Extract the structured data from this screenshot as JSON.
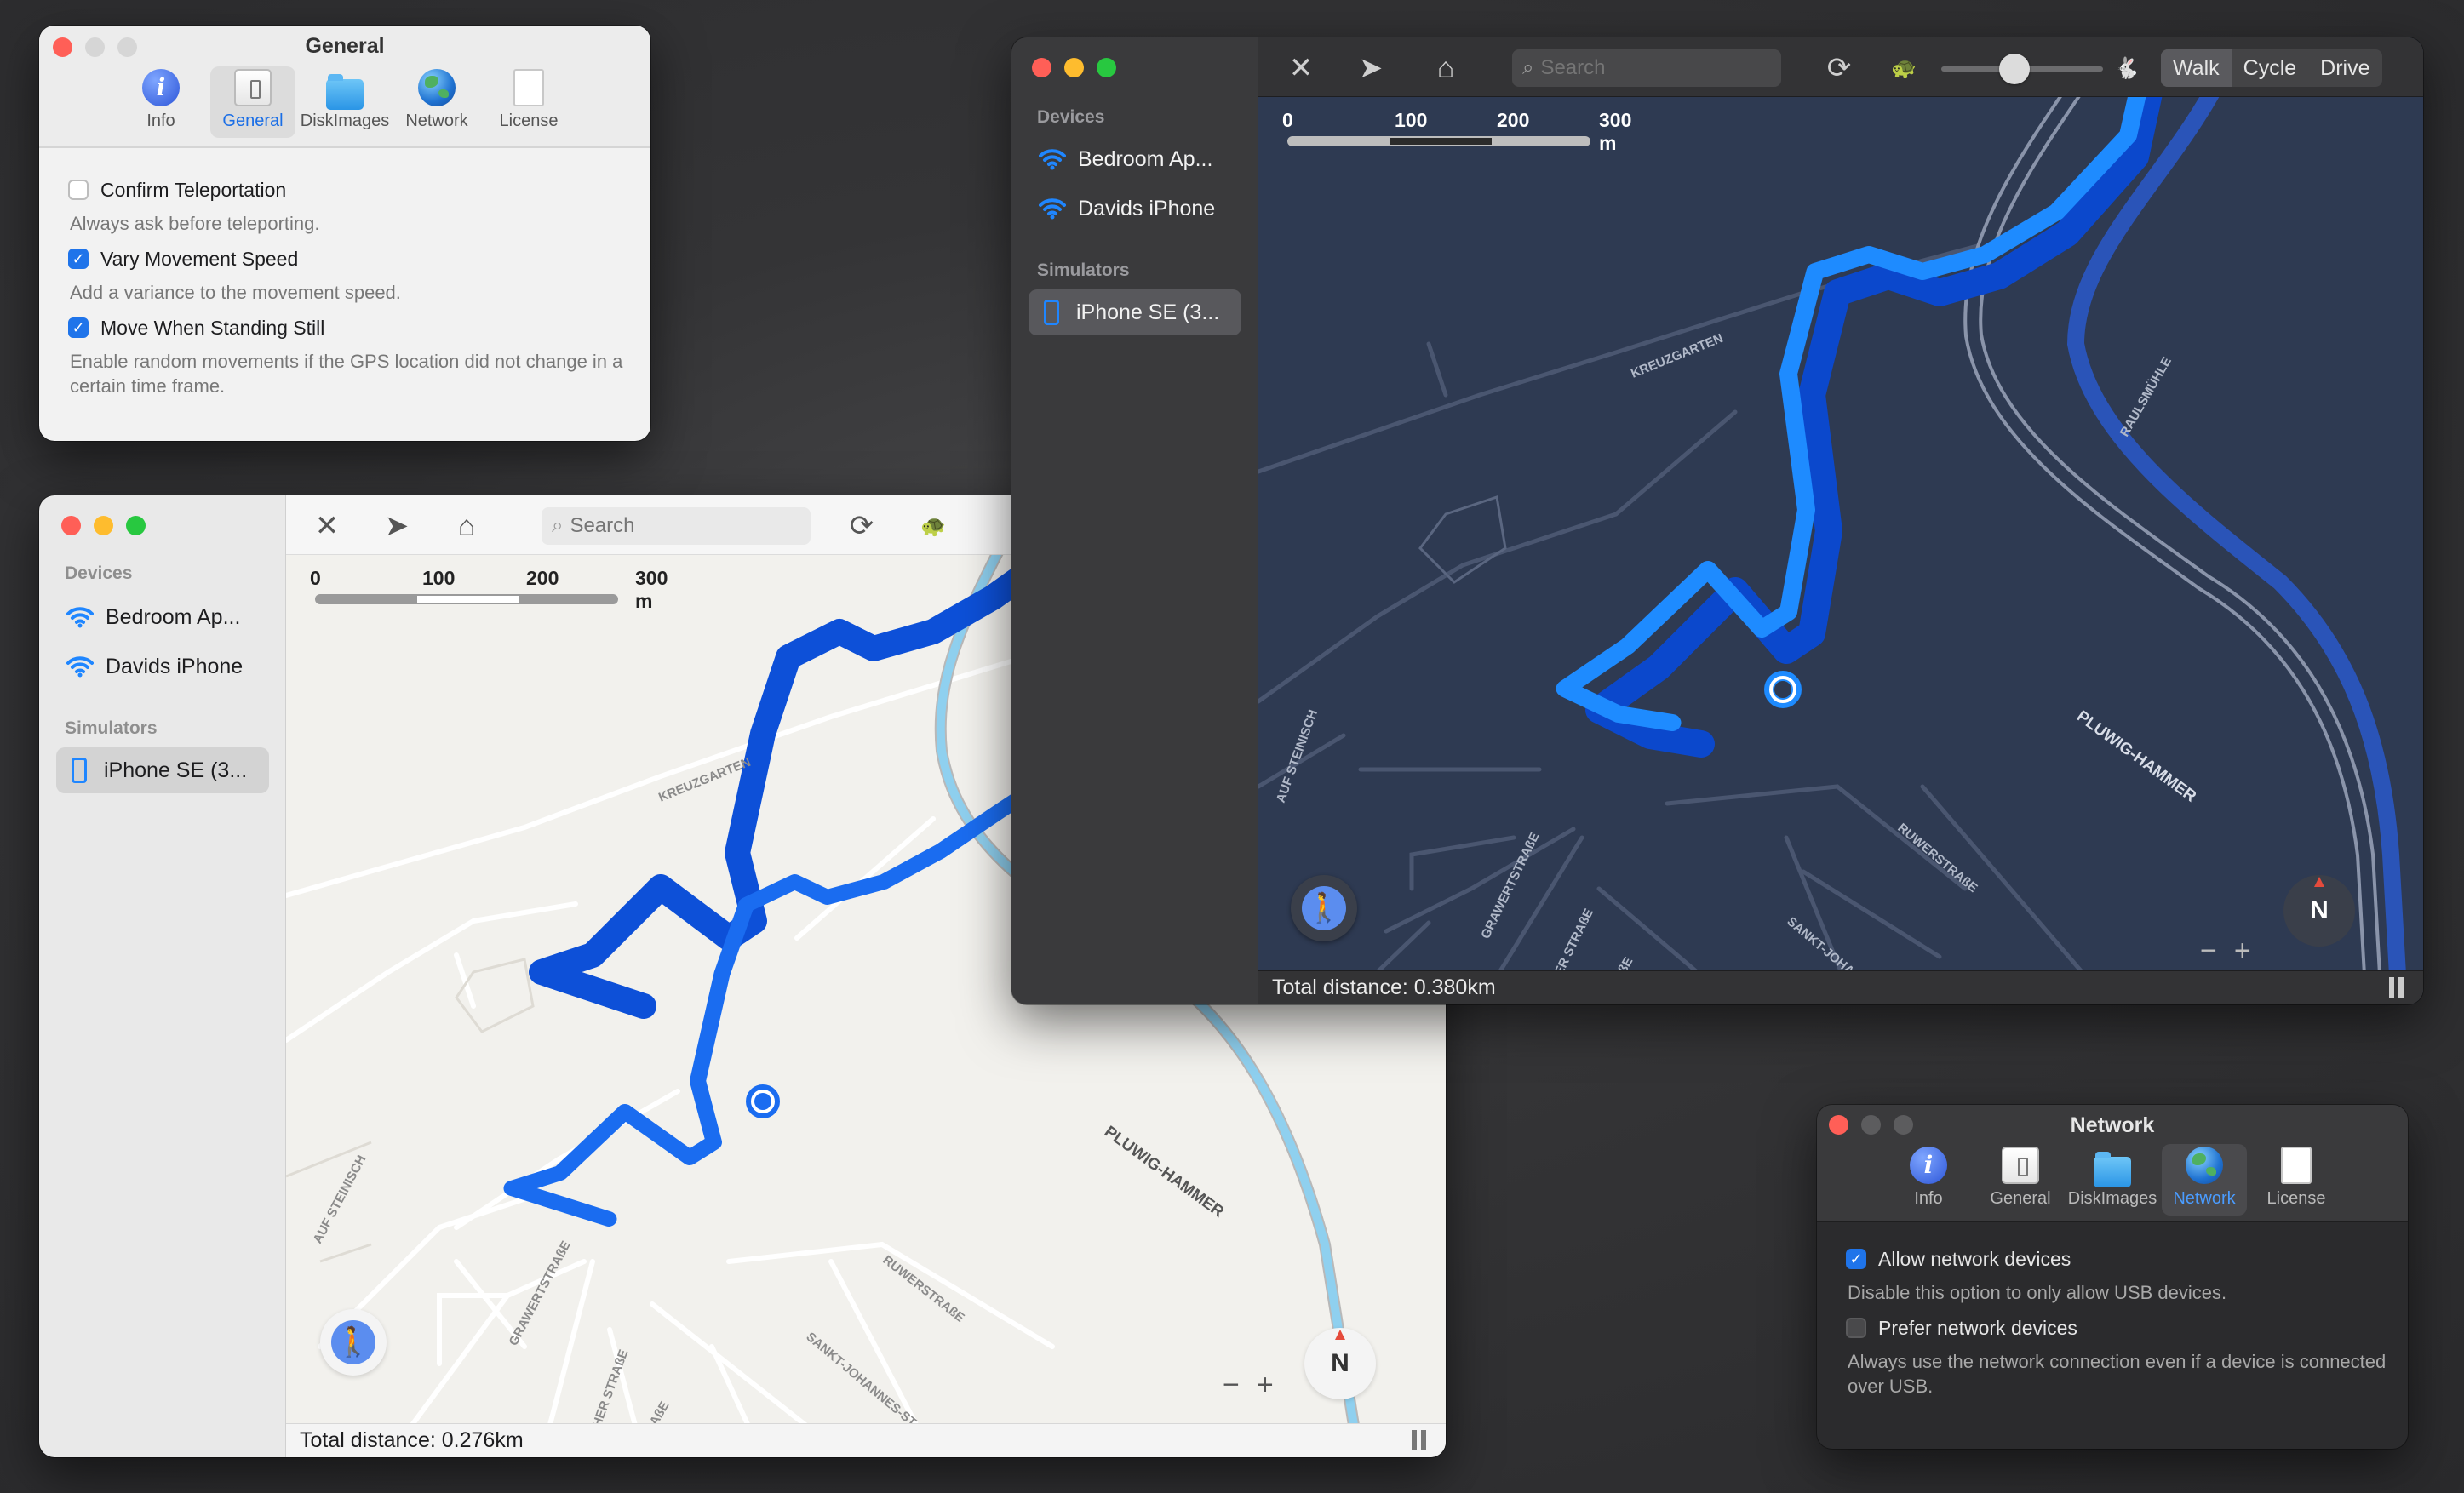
{
  "general_window": {
    "title": "General",
    "tabs": [
      {
        "label": "Info",
        "icon": "info-icon"
      },
      {
        "label": "General",
        "icon": "general-icon"
      },
      {
        "label": "DiskImages",
        "icon": "folder-icon"
      },
      {
        "label": "Network",
        "icon": "globe-icon"
      },
      {
        "label": "License",
        "icon": "document-icon"
      }
    ],
    "options": [
      {
        "label": "Confirm Teleportation",
        "checked": false,
        "description": "Always ask before teleporting."
      },
      {
        "label": "Vary Movement Speed",
        "checked": true,
        "description": "Add a variance to the movement speed."
      },
      {
        "label": "Move When Standing Still",
        "checked": true,
        "description": "Enable random movements if the GPS location did not change in a certain time frame."
      }
    ]
  },
  "network_window": {
    "title": "Network",
    "tabs": [
      {
        "label": "Info",
        "icon": "info-icon"
      },
      {
        "label": "General",
        "icon": "general-icon"
      },
      {
        "label": "DiskImages",
        "icon": "folder-icon"
      },
      {
        "label": "Network",
        "icon": "globe-icon"
      },
      {
        "label": "License",
        "icon": "document-icon"
      }
    ],
    "options": [
      {
        "label": "Allow network devices",
        "checked": true,
        "description": "Disable this option to only allow USB devices."
      },
      {
        "label": "Prefer network devices",
        "checked": false,
        "description": "Always use the network connection even if a device is connected over USB."
      }
    ]
  },
  "map_light": {
    "sidebar": {
      "devices_header": "Devices",
      "devices": [
        "Bedroom Ap...",
        "Davids iPhone"
      ],
      "simulators_header": "Simulators",
      "simulators": [
        "iPhone SE (3..."
      ]
    },
    "search_placeholder": "Search",
    "scale_labels": [
      "0",
      "100",
      "200",
      "300 m"
    ],
    "street_labels": [
      "KREUZGARTEN",
      "AUF STEINISCH",
      "GRAWERTSTRAßE",
      "RICHER STRAßE",
      "RUWERSTRAßE",
      "SANKT-JOHANNES-ST",
      "PLUWIG-HAMMER",
      "STRAßE"
    ],
    "status": "Total distance: 0.276km",
    "compass": "N",
    "zoom_out": "−",
    "zoom_in": "+"
  },
  "map_dark": {
    "sidebar": {
      "devices_header": "Devices",
      "devices": [
        "Bedroom Ap...",
        "Davids iPhone"
      ],
      "simulators_header": "Simulators",
      "simulators": [
        "iPhone SE (3..."
      ]
    },
    "search_placeholder": "Search",
    "modes": [
      "Walk",
      "Cycle",
      "Drive"
    ],
    "selected_mode": "Walk",
    "speed_slider": 0.45,
    "scale_labels": [
      "0",
      "100",
      "200",
      "300 m"
    ],
    "street_labels": [
      "KREUZGARTEN",
      "RAULSMÜHLE",
      "AUF STEINISCH",
      "PLUWIG-HAMMER",
      "RUWERSTRAßE",
      "GRAWERTSTRAßE",
      "RICHER STRAßE",
      "SANKT-JOHANNES-ST",
      "STRAßE"
    ],
    "status": "Total distance: 0.380km",
    "compass": "N",
    "zoom_out": "−",
    "zoom_in": "+"
  },
  "colors": {
    "route_light": "#1a6cf0",
    "route_dark": "#1e8bff",
    "river_light": "#8fd0ef",
    "river_dark": "#2a54b8",
    "accent": "#1f74ea"
  }
}
